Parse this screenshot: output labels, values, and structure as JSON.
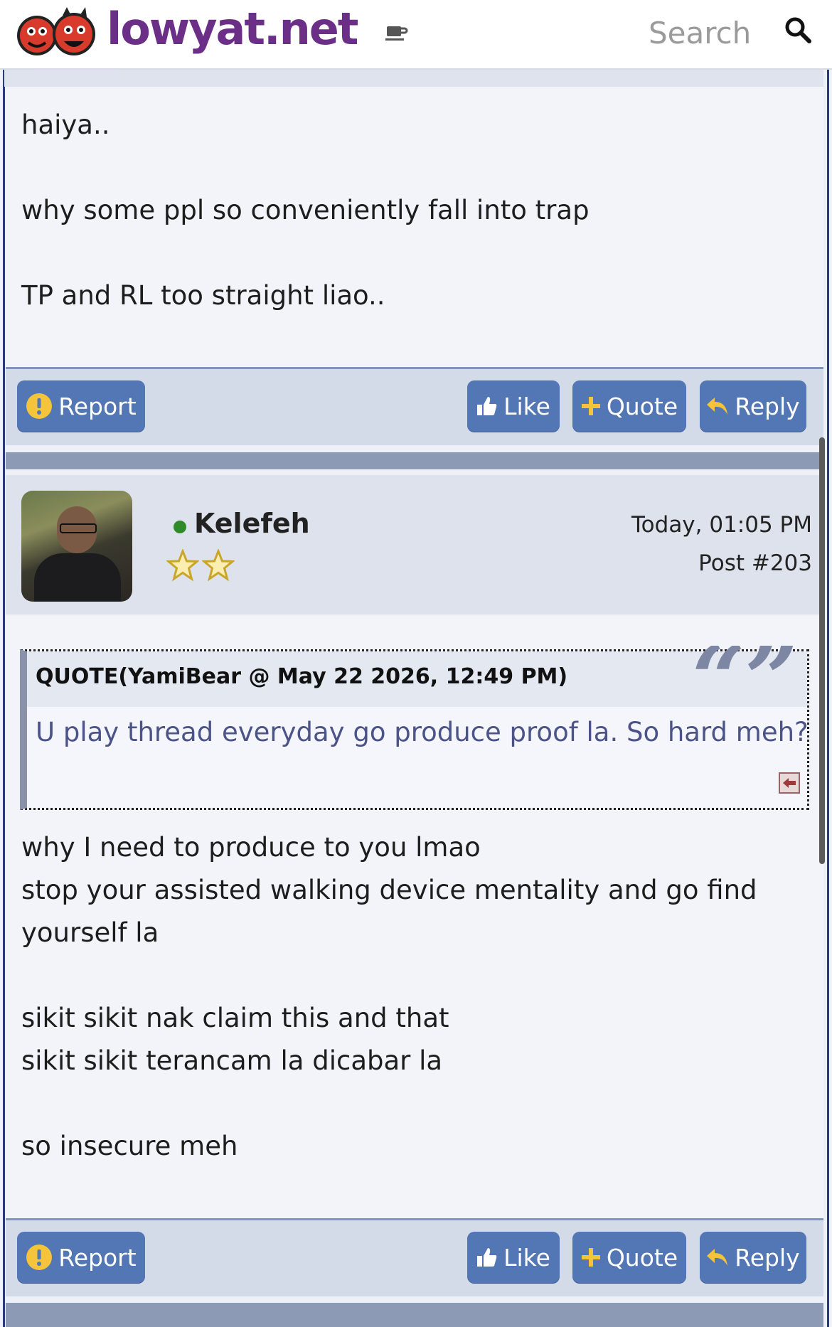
{
  "header": {
    "brand": "lowyat.net",
    "search_label": "Search",
    "icons": [
      "mascot-logo",
      "coffee-cup-icon",
      "search-icon"
    ]
  },
  "post_prev": {
    "lines": [
      "haiya..",
      "why some ppl so conveniently fall into trap",
      "TP and RL too straight liao.."
    ],
    "actions": {
      "report": "Report",
      "like": "Like",
      "quote": "Quote",
      "reply": "Reply"
    }
  },
  "post_203": {
    "username": "Kelefeh",
    "online": true,
    "stars": 2,
    "time": "Today, 01:05 PM",
    "post_number": "Post #203",
    "quote": {
      "title": "QUOTE(YamiBear @ May 22 2026, 12:49 PM)",
      "text": "U play thread everyday go produce proof la. So hard meh?"
    },
    "lines": [
      "why I need to produce to you lmao",
      "stop your assisted walking device mentality and go find",
      "yourself la",
      "sikit sikit nak claim this and that",
      "sikit sikit terancam la dicabar la",
      "so insecure meh"
    ],
    "actions": {
      "report": "Report",
      "like": "Like",
      "quote": "Quote",
      "reply": "Reply"
    }
  },
  "colors": {
    "brand": "#6b2f88",
    "button": "#5376b5",
    "action_bar": "#d3dbe8",
    "online": "#2f8a2a",
    "quote_text": "#4b5387"
  }
}
